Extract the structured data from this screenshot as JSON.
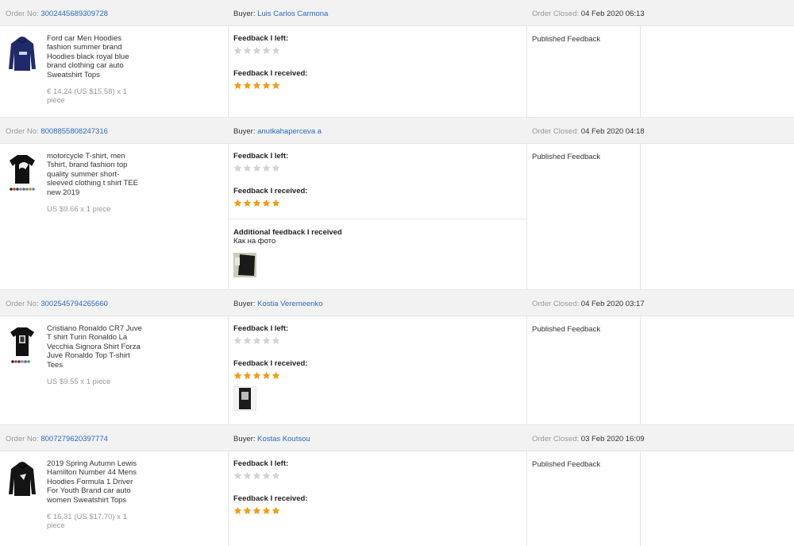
{
  "labels": {
    "order_no": "Order No:",
    "buyer": "Buyer:",
    "order_closed": "Order Closed:",
    "feedback_left": "Feedback I left:",
    "feedback_received": "Feedback I received:",
    "published_feedback": "Published Feedback",
    "additional_feedback": "Additional feedback I received"
  },
  "colors": {
    "link": "#2a6bbf",
    "star_filled": "#f39c12",
    "star_empty": "#d4d4d4",
    "header_bg": "#f2f2f2"
  },
  "orders": [
    {
      "order_no": "3002445689309728",
      "buyer": "Luis Carlos Carmona",
      "closed": "04 Feb 2020 06:13",
      "product_title": "Ford car Men Hoodies fashion summer brand Hoodies black royal blue brand clothing car auto Sweatshirt Tops",
      "price": "€ 14,24 (US $15.58) x 1 piece",
      "thumb_icon": "navy-hoodie-thumbnail",
      "stars_left": 0,
      "stars_received": 5,
      "status": "Published Feedback"
    },
    {
      "order_no": "8008855808247316",
      "buyer": "anutkahaperceva a",
      "closed": "04 Feb 2020 04:18",
      "product_title": "motorcycle T-shirt, men Tshirt, brand fashion top quality summer short-sleeved clothing t shirt TEE new 2019",
      "price": "US $9.66 x 1 piece",
      "thumb_icon": "black-tshirt-thumbnail",
      "stars_left": 0,
      "stars_received": 5,
      "status": "Published Feedback",
      "additional_feedback": "Как на фото"
    },
    {
      "order_no": "3002545794265660",
      "buyer": "Kostia Veremeenko",
      "closed": "04 Feb 2020 03:17",
      "product_title": "Cristiano Ronaldo CR7 Juve T shirt Turin Ronaldo La Vecchia Signora Shirt Forza Juve Ronaldo Top T-shirt Tees",
      "price": "US $9.55 x 1 piece",
      "thumb_icon": "black-tshirt-thumbnail",
      "stars_left": 0,
      "stars_received": 5,
      "status": "Published Feedback"
    },
    {
      "order_no": "8007279620397774",
      "buyer": "Kostas Koutsou",
      "closed": "03 Feb 2020 16:09",
      "product_title": "2019 Spring Autumn Lewis Hamilton Number 44 Mens Hoodies Formula 1 Driver For Youth Brand car auto women Sweatshirt Tops",
      "price": "€ 16,31 (US $17.70) x 1 piece",
      "thumb_icon": "black-hoodie-thumbnail",
      "stars_left": 0,
      "stars_received": 5,
      "status": "Published Feedback"
    }
  ]
}
